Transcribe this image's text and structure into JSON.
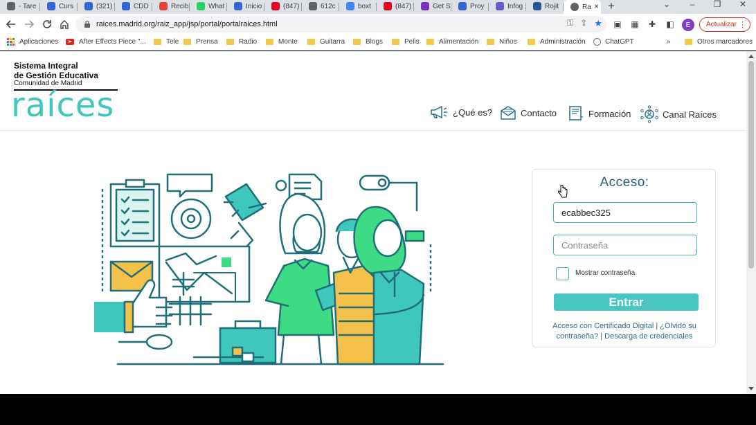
{
  "browser": {
    "tabs": [
      {
        "label": "- Tare",
        "color": "#5f6368"
      },
      {
        "label": "Curs",
        "color": "#3367d6"
      },
      {
        "label": "(321)",
        "color": "#3367d6"
      },
      {
        "label": "CDD",
        "color": "#3367d6"
      },
      {
        "label": "Recib",
        "color": "#ea4335"
      },
      {
        "label": "What",
        "color": "#25d366"
      },
      {
        "label": "Inicio",
        "color": "#3367d6"
      },
      {
        "label": "(847)",
        "color": "#e60023"
      },
      {
        "label": "612c",
        "color": "#5f6368"
      },
      {
        "label": "boxt",
        "color": "#4285f4"
      },
      {
        "label": "(847)",
        "color": "#e60023"
      },
      {
        "label": "Get S",
        "color": "#7b2fbf"
      },
      {
        "label": "Proy",
        "color": "#3367d6"
      },
      {
        "label": "Infog",
        "color": "#6a5acd"
      },
      {
        "label": "Rojit",
        "color": "#2b579a"
      }
    ],
    "active_tab": {
      "label": "Ra",
      "color": "#5f6368"
    },
    "url": "raices.madrid.org/raiz_app/jsp/portal/portalraices.html",
    "profile_initial": "E",
    "update_label": "Actualizar",
    "bookmarks": [
      {
        "label": "Aplicaciones",
        "icon": "apps-icon"
      },
      {
        "label": "After Effects Piece \"...",
        "icon": "youtube-icon"
      },
      {
        "label": "Tele",
        "icon": "folder-icon"
      },
      {
        "label": "Prensa",
        "icon": "folder-icon"
      },
      {
        "label": "Radio",
        "icon": "folder-icon"
      },
      {
        "label": "Monte",
        "icon": "folder-icon"
      },
      {
        "label": "Guitarra",
        "icon": "folder-icon"
      },
      {
        "label": "Blogs",
        "icon": "folder-icon"
      },
      {
        "label": "Pelis",
        "icon": "folder-icon"
      },
      {
        "label": "Alimentación",
        "icon": "folder-icon"
      },
      {
        "label": "Niños",
        "icon": "folder-icon"
      },
      {
        "label": "Administración",
        "icon": "folder-icon"
      },
      {
        "label": "ChatGPT",
        "icon": "chatgpt-icon"
      }
    ],
    "more_bookmarks": "»",
    "other_bookmarks": "Otros marcadores"
  },
  "header": {
    "org_line1": "Sistema Integral",
    "org_line2": "de Gestión Educativa",
    "org_line3": "Comunidad de Madrid",
    "brand": "raíces",
    "nav": [
      {
        "label": "¿Qué es?",
        "icon": "megaphone-icon"
      },
      {
        "label": "Contacto",
        "icon": "envelope-icon"
      },
      {
        "label": "Formación",
        "icon": "book-icon"
      },
      {
        "label": "Canal Raíces",
        "icon": "network-icon"
      }
    ]
  },
  "login": {
    "title": "Acceso:",
    "username_value": "ecabbec325",
    "password_placeholder": "Contraseña",
    "show_password_label": "Mostrar contraseña",
    "submit_label": "Entrar",
    "link_certificate": "Acceso con Certificado Digital",
    "link_forgot": "¿Olvidó su contraseña?",
    "link_download": "Descarga de credenciales",
    "separator": "|"
  },
  "colors": {
    "brand_teal": "#3fc6bd",
    "button_teal": "#4ac7c2",
    "illustration_dark": "#1f6f78",
    "illustration_green": "#3ddc84",
    "illustration_yellow": "#f5c04a"
  }
}
